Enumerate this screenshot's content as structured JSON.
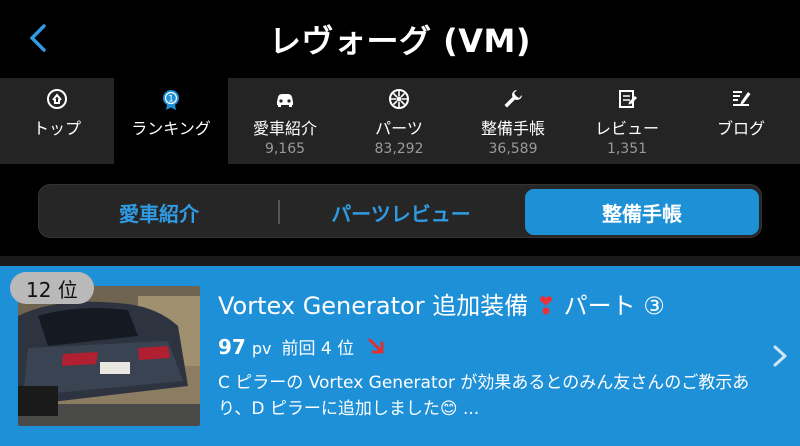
{
  "header": {
    "title": "レヴォーグ (VM)"
  },
  "tabs": [
    {
      "label": "トップ",
      "count": "",
      "icon": "home-icon"
    },
    {
      "label": "ランキング",
      "count": "",
      "icon": "medal-icon"
    },
    {
      "label": "愛車紹介",
      "count": "9,165",
      "icon": "car-icon"
    },
    {
      "label": "パーツ",
      "count": "83,292",
      "icon": "wheel-icon"
    },
    {
      "label": "整備手帳",
      "count": "36,589",
      "icon": "wrench-icon"
    },
    {
      "label": "レビュー",
      "count": "1,351",
      "icon": "review-icon"
    },
    {
      "label": "ブログ",
      "count": "",
      "icon": "blog-icon"
    }
  ],
  "segments": {
    "s1": "愛車紹介",
    "s2": "パーツレビュー",
    "s3": "整備手帳",
    "selected": "整備手帳"
  },
  "item": {
    "rank": "12 位",
    "title_main": "Vortex Generator 追加装備",
    "title_heart": "❣",
    "title_tail": "パート ③",
    "pv": "97",
    "pv_unit": "pv",
    "previous": "前回 4 位",
    "description": "C ピラーの Vortex Generator が効果あるとのみん友さんのご教示あり、D ピラーに追加しました😊 ..."
  },
  "colors": {
    "accent": "#1e90d6",
    "item_bg": "#1d90d8",
    "tab_bg": "#242424",
    "trend_down": "#e03030"
  }
}
